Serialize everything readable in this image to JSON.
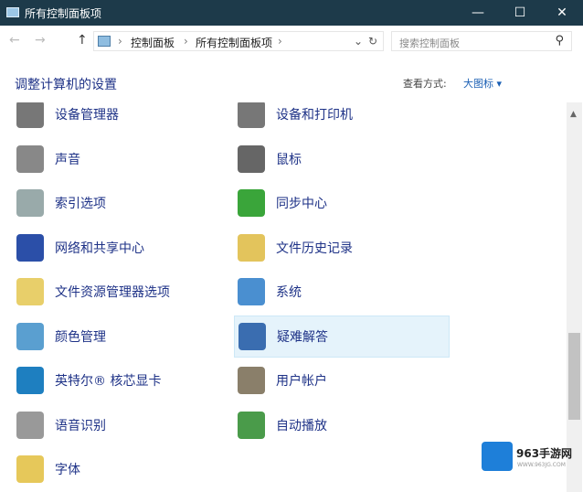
{
  "window": {
    "title": "所有控制面板项",
    "minimize": "—",
    "maximize": "☐",
    "close": "✕"
  },
  "nav": {
    "back": "←",
    "forward": "→",
    "up": "↑",
    "breadcrumb": [
      "控制面板",
      "所有控制面板项"
    ],
    "sep": "›",
    "dropdown": "⌄",
    "refresh": "↻",
    "search_placeholder": "搜索控制面板",
    "search_icon": "⚲"
  },
  "header": {
    "title": "调整计算机的设置",
    "view_by_label": "查看方式:",
    "view_by_value": "大图标 ▾"
  },
  "items_left": [
    {
      "label": "设备管理器",
      "icon": "device-manager-icon",
      "color": "#777"
    },
    {
      "label": "声音",
      "icon": "speaker-icon",
      "color": "#888"
    },
    {
      "label": "索引选项",
      "icon": "indexing-icon",
      "color": "#9aa"
    },
    {
      "label": "网络和共享中心",
      "icon": "network-icon",
      "color": "#2b4fa8"
    },
    {
      "label": "文件资源管理器选项",
      "icon": "folder-options-icon",
      "color": "#e8cf6a"
    },
    {
      "label": "颜色管理",
      "icon": "color-management-icon",
      "color": "#5a9fd0"
    },
    {
      "label": "英特尔® 核芯显卡",
      "icon": "intel-graphics-icon",
      "color": "#1e7fc0"
    },
    {
      "label": "语音识别",
      "icon": "microphone-icon",
      "color": "#999"
    },
    {
      "label": "字体",
      "icon": "fonts-icon",
      "color": "#e6c85a"
    }
  ],
  "items_right": [
    {
      "label": "设备和打印机",
      "icon": "printer-icon",
      "color": "#777"
    },
    {
      "label": "鼠标",
      "icon": "mouse-icon",
      "color": "#666"
    },
    {
      "label": "同步中心",
      "icon": "sync-icon",
      "color": "#3aa53a"
    },
    {
      "label": "文件历史记录",
      "icon": "file-history-icon",
      "color": "#e3c45c"
    },
    {
      "label": "系统",
      "icon": "system-icon",
      "color": "#4a8fd0"
    },
    {
      "label": "疑难解答",
      "icon": "troubleshooting-icon",
      "color": "#3a6db0"
    },
    {
      "label": "用户帐户",
      "icon": "user-accounts-icon",
      "color": "#8a7f6a"
    },
    {
      "label": "自动播放",
      "icon": "autoplay-icon",
      "color": "#4a9b4a"
    }
  ],
  "watermark": {
    "name": "963手游网",
    "url": "WWW.963JG.COM"
  }
}
